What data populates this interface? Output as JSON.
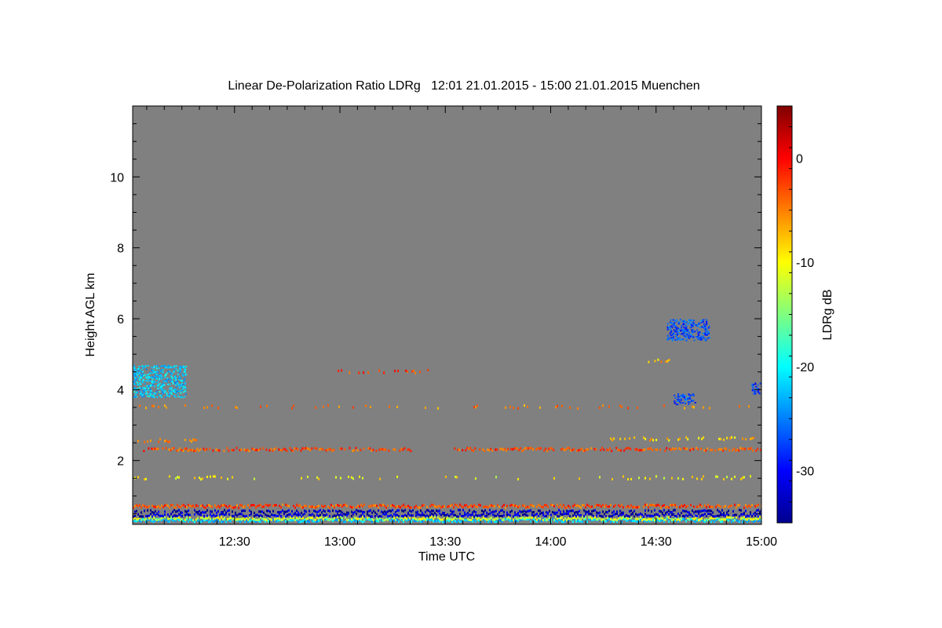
{
  "chart_data": {
    "type": "heatmap",
    "title": "Linear De-Polarization Ratio LDRg   12:01 21.01.2015 - 15:00 21.01.2015 Muenchen",
    "xlabel": "Time UTC",
    "ylabel": "Height AGL km",
    "colorbar_label": "LDRg dB",
    "xlim_minutes": [
      721,
      900
    ],
    "ylim_km": [
      0.2,
      12.0
    ],
    "x_ticks": [
      {
        "minute": 750,
        "label": "12:30"
      },
      {
        "minute": 780,
        "label": "13:00"
      },
      {
        "minute": 810,
        "label": "13:30"
      },
      {
        "minute": 840,
        "label": "14:00"
      },
      {
        "minute": 870,
        "label": "14:30"
      },
      {
        "minute": 900,
        "label": "15:00"
      }
    ],
    "y_ticks": [
      {
        "value": 2,
        "label": "2"
      },
      {
        "value": 4,
        "label": "4"
      },
      {
        "value": 6,
        "label": "6"
      },
      {
        "value": 8,
        "label": "8"
      },
      {
        "value": 10,
        "label": "10"
      }
    ],
    "colorbar_range_db": [
      -35,
      5
    ],
    "colorbar_ticks": [
      {
        "value": 0,
        "label": "0"
      },
      {
        "value": -10,
        "label": "-10"
      },
      {
        "value": -20,
        "label": "-20"
      },
      {
        "value": -30,
        "label": "-30"
      }
    ],
    "no_data_color": "#808080",
    "layers": [
      {
        "height_km": 0.3,
        "ldr_db": -22,
        "start_min": 721,
        "end_min": 900,
        "density": 1.0,
        "desc": "near-surface cyan band"
      },
      {
        "height_km": 0.35,
        "ldr_db": -12,
        "start_min": 721,
        "end_min": 900,
        "density": 0.9,
        "desc": "near-surface yellow band"
      },
      {
        "height_km": 0.45,
        "ldr_db": -32,
        "start_min": 721,
        "end_min": 900,
        "density": 0.9,
        "desc": "near-surface blue band"
      },
      {
        "height_km": 0.55,
        "ldr_db": -33,
        "start_min": 721,
        "end_min": 900,
        "density": 0.7,
        "desc": "near-surface blue band"
      },
      {
        "height_km": 0.7,
        "ldr_db": -3,
        "start_min": 721,
        "end_min": 900,
        "density": 0.9,
        "desc": "red layer"
      },
      {
        "height_km": 1.5,
        "ldr_db": -10,
        "start_min": 721,
        "end_min": 900,
        "density": 0.15,
        "desc": "sparse yellow layer"
      },
      {
        "height_km": 2.3,
        "ldr_db": -3,
        "start_min": 724,
        "end_min": 800,
        "density": 0.75,
        "desc": "red layer"
      },
      {
        "height_km": 2.3,
        "ldr_db": -3,
        "start_min": 812,
        "end_min": 900,
        "density": 0.7,
        "desc": "red layer"
      },
      {
        "height_km": 2.55,
        "ldr_db": -6,
        "start_min": 721,
        "end_min": 740,
        "density": 0.25,
        "desc": "sparse layer"
      },
      {
        "height_km": 2.6,
        "ldr_db": -8,
        "start_min": 856,
        "end_min": 898,
        "density": 0.35,
        "desc": "sparse yellow layer"
      },
      {
        "height_km": 3.5,
        "ldr_db": -5,
        "start_min": 721,
        "end_min": 900,
        "density": 0.2,
        "desc": "sparse orange layer"
      },
      {
        "height_km": 4.5,
        "ldr_db": -2,
        "start_min": 778,
        "end_min": 806,
        "density": 0.35,
        "desc": "sparse red layer"
      },
      {
        "height_km": 4.8,
        "ldr_db": -7,
        "start_min": 865,
        "end_min": 876,
        "density": 0.2,
        "desc": "sparse layer"
      }
    ],
    "patches": [
      {
        "t_min": 721,
        "t_max": 736,
        "h_min": 3.8,
        "h_max": 4.7,
        "ldr_db": -22,
        "desc": "cyan patch near 4.3 km"
      },
      {
        "t_min": 873,
        "t_max": 885,
        "h_min": 5.4,
        "h_max": 6.0,
        "ldr_db": -27,
        "desc": "blue patch near 5.7 km"
      },
      {
        "t_min": 875,
        "t_max": 881,
        "h_min": 3.6,
        "h_max": 3.9,
        "ldr_db": -27,
        "desc": "blue patch near 3.75 km"
      },
      {
        "t_min": 897,
        "t_max": 900,
        "h_min": 3.9,
        "h_max": 4.2,
        "ldr_db": -28,
        "desc": "blue patch near 4.05 km"
      }
    ]
  }
}
